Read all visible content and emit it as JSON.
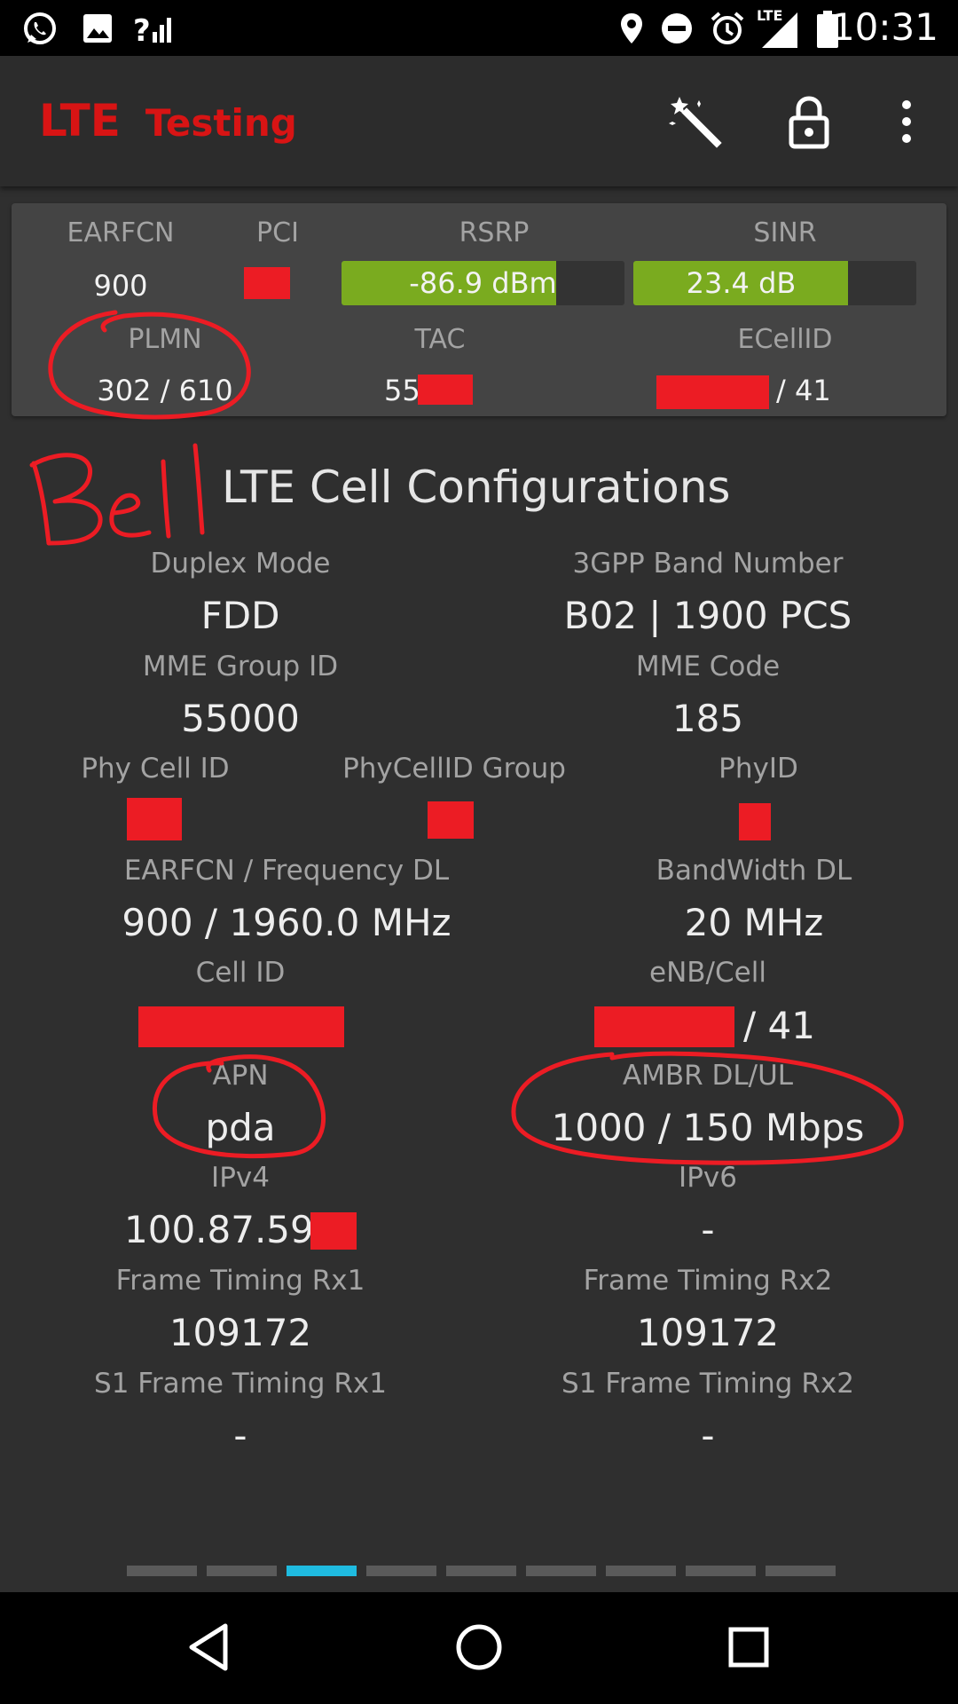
{
  "status_bar": {
    "time": "10:31",
    "left_icons": [
      "whatsapp-icon",
      "image-icon",
      "signal-unknown-icon"
    ],
    "right_icons": [
      "location-icon",
      "dnd-icon",
      "alarm-icon",
      "lte-signal-icon",
      "battery-icon"
    ],
    "lte_badge": "LTE"
  },
  "app_bar": {
    "title_lte": "LTE",
    "title_testing": "Testing",
    "actions": [
      "magic-wand-icon",
      "lock-icon",
      "more-vert-icon"
    ]
  },
  "summary": {
    "earfcn_label": "EARFCN",
    "earfcn_value": "900",
    "pci_label": "PCI",
    "rsrp_label": "RSRP",
    "rsrp_value": "-86.9 dBm",
    "rsrp_fill_fraction": 0.76,
    "sinr_label": "SINR",
    "sinr_value": "23.4 dB",
    "sinr_fill_fraction": 0.76,
    "plmn_label": "PLMN",
    "plmn_value": "302 / 610",
    "tac_label": "TAC",
    "tac_value_prefix": "55",
    "ecellid_label": "ECellID",
    "ecellid_suffix": "/ 41"
  },
  "annotation": {
    "handwritten": "Bell",
    "color": "#ec1c24"
  },
  "section": {
    "title": "LTE Cell Configurations",
    "duplex_mode_label": "Duplex Mode",
    "duplex_mode_value": "FDD",
    "band_label": "3GPP Band Number",
    "band_value": "B02 | 1900 PCS",
    "mme_group_label": "MME Group ID",
    "mme_group_value": "55000",
    "mme_code_label": "MME Code",
    "mme_code_value": "185",
    "phy_cell_id_label": "Phy Cell ID",
    "phycellid_group_label": "PhyCellID Group",
    "phyid_label": "PhyID",
    "earfcn_freq_label": "EARFCN / Frequency DL",
    "earfcn_freq_value": "900 / 1960.0 MHz",
    "bandwidth_label": "BandWidth DL",
    "bandwidth_value": "20 MHz",
    "cell_id_label": "Cell ID",
    "enb_cell_label": "eNB/Cell",
    "enb_cell_suffix": "/ 41",
    "apn_label": "APN",
    "apn_value": "pda",
    "ambr_label": "AMBR DL/UL",
    "ambr_value": "1000 / 150 Mbps",
    "ipv4_label": "IPv4",
    "ipv4_value": "100.87.59.",
    "ipv6_label": "IPv6",
    "ipv6_value": "-",
    "ftrx1_label": "Frame Timing Rx1",
    "ftrx1_value": "109172",
    "ftrx2_label": "Frame Timing Rx2",
    "ftrx2_value": "109172",
    "s1rx1_label": "S1 Frame Timing Rx1",
    "s1rx1_value": "-",
    "s1rx2_label": "S1 Frame Timing Rx2",
    "s1rx2_value": "-"
  },
  "pager": {
    "page_count": 9,
    "active_index": 2,
    "active_color": "#1fbbe0"
  },
  "nav_bar": {
    "buttons": [
      "back-icon",
      "home-icon",
      "recents-icon"
    ]
  },
  "colors": {
    "accent_red": "#d81414",
    "meter_green": "#7aab1f",
    "background": "#2f2f2f"
  }
}
